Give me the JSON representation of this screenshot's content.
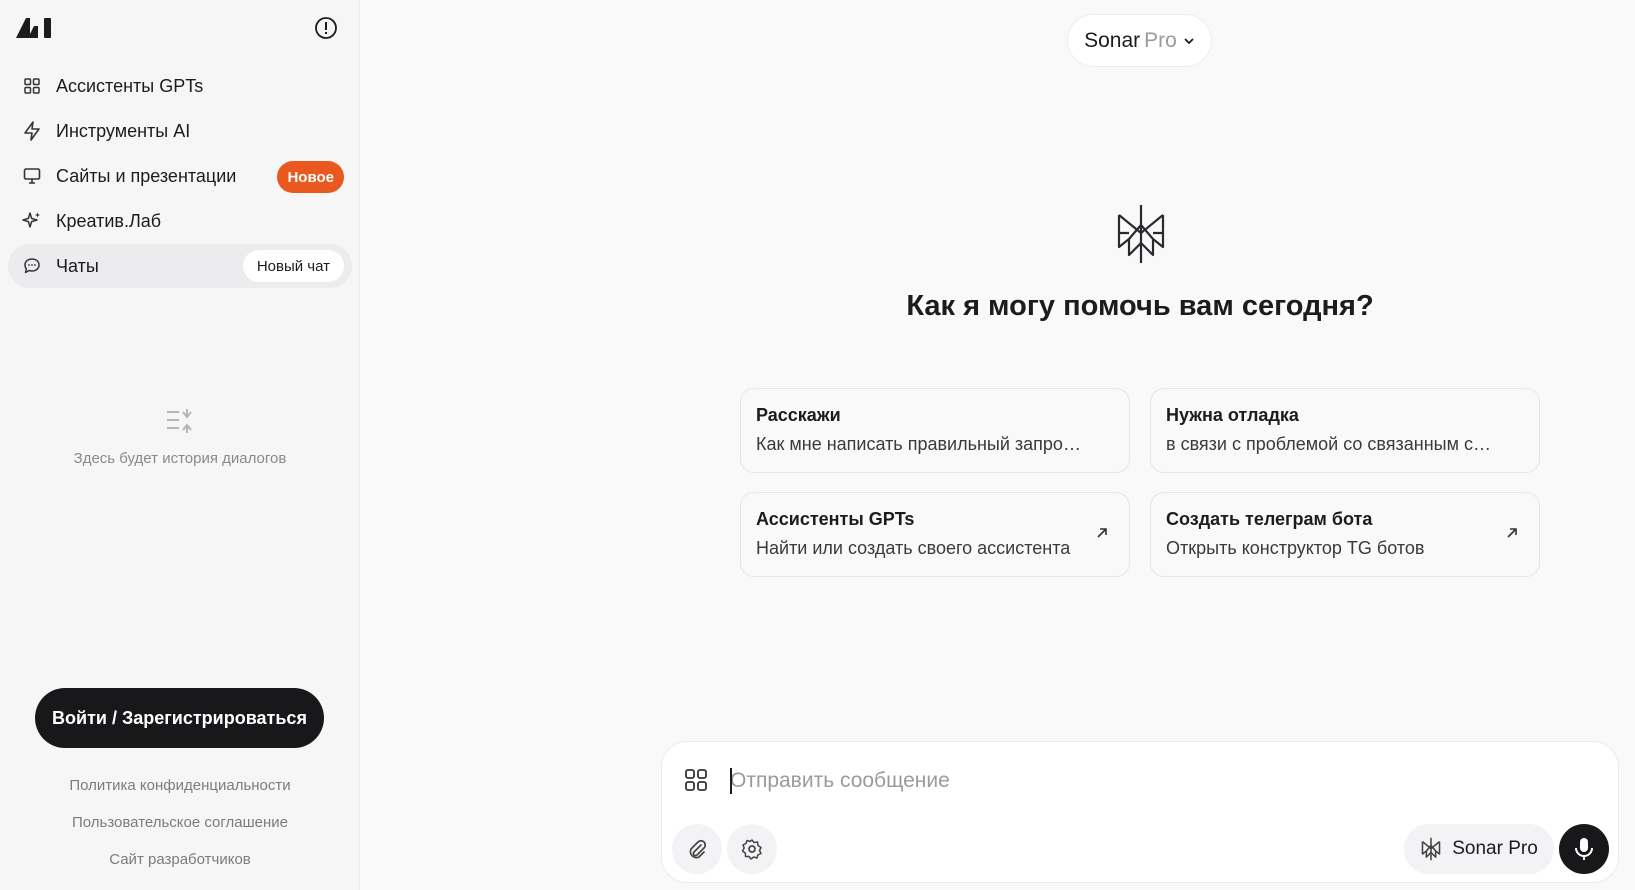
{
  "sidebar": {
    "items": [
      {
        "label": "Ассистенты GPTs",
        "icon": "grid-icon"
      },
      {
        "label": "Инструменты AI",
        "icon": "lightning-icon"
      },
      {
        "label": "Сайты и презентации",
        "icon": "monitor-icon",
        "badge": "Новое"
      },
      {
        "label": "Креатив.Лаб",
        "icon": "sparkle-icon"
      },
      {
        "label": "Чаты",
        "icon": "chat-bubble-icon",
        "action": "Новый чат"
      }
    ],
    "empty_history": "Здесь будет история диалогов",
    "login_label": "Войти / Зарегистрироваться",
    "footer_links": [
      "Политика конфиденциальности",
      "Пользовательское соглашение",
      "Сайт разработчиков"
    ]
  },
  "header": {
    "model_name": "Sonar",
    "model_suffix": "Pro"
  },
  "main": {
    "greeting": "Как я могу помочь вам сегодня?",
    "cards": [
      {
        "title": "Расскажи",
        "subtitle": "Как мне написать правильный запрос в чат"
      },
      {
        "title": "Нужна отладка",
        "subtitle": "в связи с проблемой со связанным списком"
      },
      {
        "title": "Ассистенты GPTs",
        "subtitle": "Найти или создать своего ассистента"
      },
      {
        "title": "Создать телеграм бота",
        "subtitle": "Открыть конструктор TG ботов"
      }
    ]
  },
  "composer": {
    "placeholder": "Отправить сообщение",
    "model_chip": "Sonar Pro"
  },
  "colors": {
    "accent": "#e9581f",
    "dark": "#18181a"
  }
}
